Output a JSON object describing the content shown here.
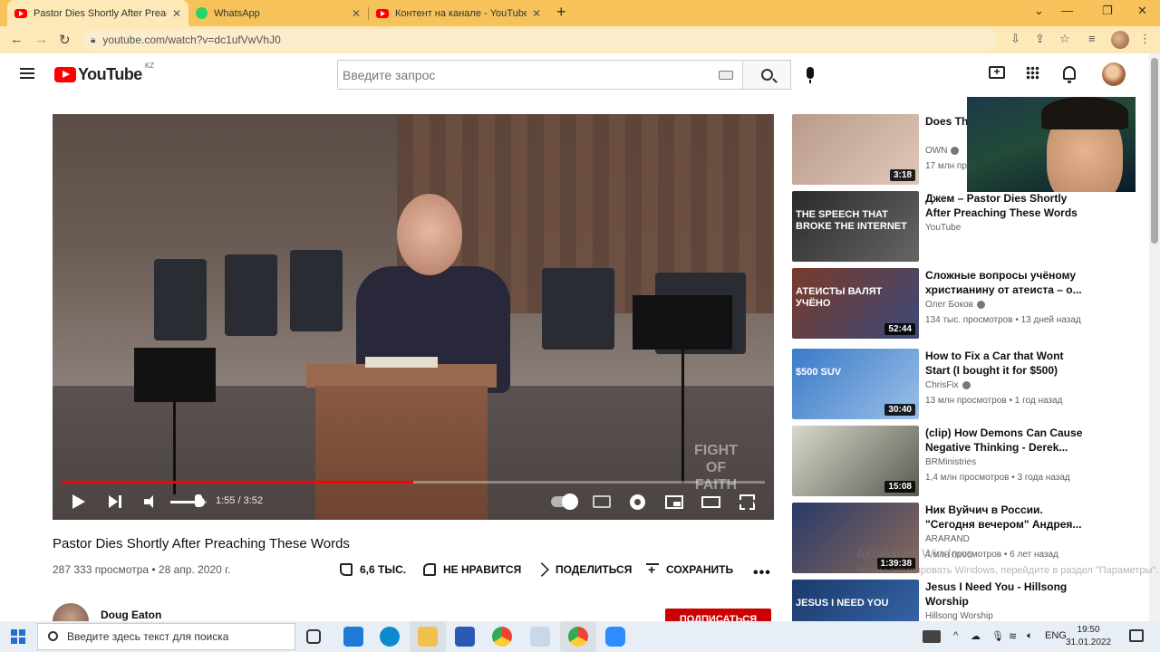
{
  "browser": {
    "tabs": [
      {
        "title": "Pastor Dies Shortly After Preaching",
        "icon": "youtube-icon",
        "active": true
      },
      {
        "title": "WhatsApp",
        "icon": "whatsapp-icon",
        "active": false
      },
      {
        "title": "Контент на канале - YouTube St",
        "icon": "youtube-icon",
        "active": false
      }
    ],
    "url": "youtube.com/watch?v=dc1ufVwVhJ0"
  },
  "youtube": {
    "logo_text": "YouTube",
    "country_code": "KZ",
    "search_placeholder": "Введите запрос"
  },
  "player": {
    "progress": 0.5,
    "volume": 0.7,
    "time": "1:55 / 3:52",
    "watermark_line1": "FIGHT",
    "watermark_line2": "OF",
    "watermark_line3": "FAITH"
  },
  "video": {
    "title": "Pastor Dies Shortly After Preaching These Words",
    "views_date": "287 333 просмотра • 28 апр. 2020 г.",
    "likes": "6,6 ТЫС.",
    "dislike_label": "НЕ НРАВИТСЯ",
    "share_label": "ПОДЕЛИТЬСЯ",
    "save_label": "СОХРАНИТЬ",
    "more": "•••",
    "channel": "Doug Eaton",
    "subscribe_label": "ПОДПИСАТЬСЯ"
  },
  "recommendations": [
    {
      "title": "Does Thi Understa",
      "channel": "OWN",
      "verified": true,
      "meta": "17 млн пр",
      "duration": "3:18",
      "overlay": "",
      "colors": [
        "#b89a8a",
        "#e0c8b8"
      ]
    },
    {
      "title": "Джем – Pastor Dies Shortly After Preaching These Words",
      "channel": "YouTube",
      "verified": false,
      "meta": "",
      "duration": "",
      "overlay": "THE SPEECH THAT BROKE THE INTERNET",
      "colors": [
        "#2a2a2a",
        "#666"
      ]
    },
    {
      "title": "Сложные вопросы учёному христианину от атеиста – о...",
      "channel": "Олег Боков",
      "verified": true,
      "meta": "134 тыс. просмотров • 13 дней назад",
      "duration": "52:44",
      "overlay": "АТЕИСТЫ ВАЛЯТ УЧЁНО",
      "colors": [
        "#7a3a2a",
        "#3a4a7a"
      ]
    },
    {
      "title": "How to Fix a Car that Wont Start (I bought it for $500)",
      "channel": "ChrisFix",
      "verified": true,
      "meta": "13 млн просмотров • 1 год назад",
      "duration": "30:40",
      "overlay": "$500 SUV",
      "colors": [
        "#3a7ac8",
        "#9ac0e8"
      ]
    },
    {
      "title": "(clip) How Demons Can Cause Negative Thinking - Derek...",
      "channel": "BRMinistries",
      "verified": false,
      "meta": "1,4 млн просмотров • 3 года назад",
      "duration": "15:08",
      "overlay": "",
      "colors": [
        "#d8d8cc",
        "#5a5a50"
      ]
    },
    {
      "title": "Ник Вуйчич в России. \"Сегодня вечером\" Андрея...",
      "channel": "ARARAND",
      "verified": false,
      "meta": "4 млн просмотров • 6 лет назад",
      "duration": "1:39:38",
      "overlay": "",
      "colors": [
        "#2a3a6a",
        "#8a6a5a"
      ]
    },
    {
      "title": "Jesus I Need You - Hillsong Worship",
      "channel": "Hillsong Worship",
      "verified": false,
      "meta": "",
      "duration": "",
      "overlay": "JESUS I NEED YOU",
      "colors": [
        "#1a3a6a",
        "#3a6ab0"
      ]
    }
  ],
  "activation": {
    "line1": "Активация Windows",
    "line2": "Чтобы активировать Windows, перейдите в раздел \"Параметры\"."
  },
  "taskbar": {
    "search_placeholder": "Введите здесь текст для поиска",
    "lang": "ENG",
    "time": "19:50",
    "date": "31.01.2022"
  }
}
